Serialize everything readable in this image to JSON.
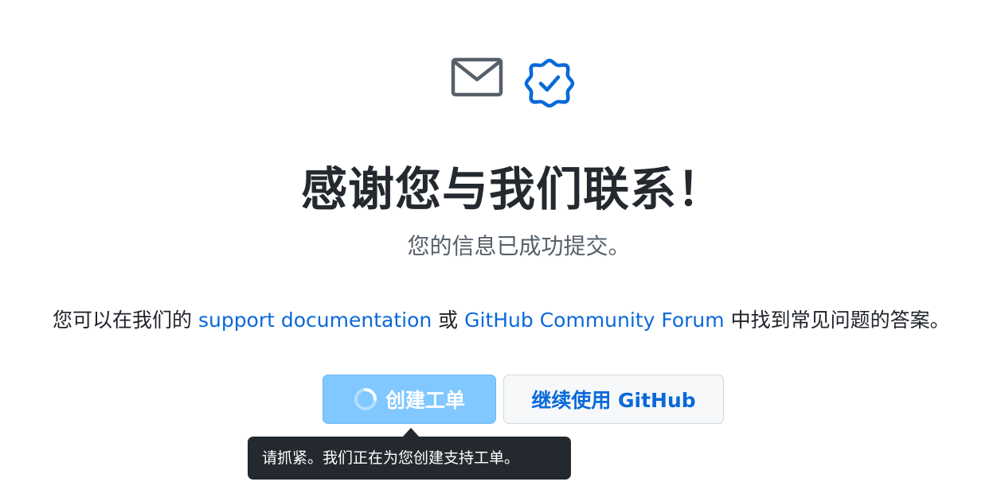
{
  "icons": {
    "mail": "mail-icon",
    "verified": "verified-badge-icon"
  },
  "title": "感谢您与我们联系！",
  "subtitle": "您的信息已成功提交。",
  "help": {
    "prefix": "您可以在我们的 ",
    "link1": "support documentation",
    "middle": " 或 ",
    "link2": "GitHub Community Forum",
    "suffix": " 中找到常见问题的答案。"
  },
  "buttons": {
    "create_ticket": "创建工单",
    "continue": "继续使用 GitHub"
  },
  "tooltip": "请抓紧。我们正在为您创建支持工单。",
  "colors": {
    "link": "#0969da",
    "primary_button": "#80c8ff",
    "tooltip_bg": "#24292f",
    "icon_gray": "#57606a",
    "icon_blue": "#0969da"
  }
}
